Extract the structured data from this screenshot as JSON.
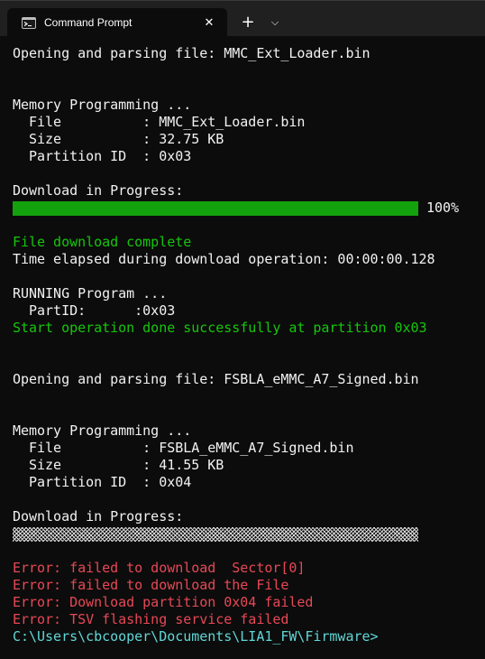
{
  "window": {
    "title": "Command Prompt",
    "close_glyph": "✕",
    "new_tab_glyph": "+",
    "dropdown_glyph": "⌵",
    "app_icon": "console-icon"
  },
  "console": {
    "lines": [
      {
        "text": "Opening and parsing file: MMC_Ext_Loader.bin",
        "color": "white"
      },
      {
        "text": "",
        "color": "white"
      },
      {
        "text": "",
        "color": "white"
      },
      {
        "text": "Memory Programming ...",
        "color": "white"
      },
      {
        "text": "  File          : MMC_Ext_Loader.bin",
        "color": "white"
      },
      {
        "text": "  Size          : 32.75 KB",
        "color": "white"
      },
      {
        "text": "  Partition ID  : 0x03",
        "color": "white"
      },
      {
        "text": "",
        "color": "white"
      },
      {
        "text": "Download in Progress:",
        "color": "white"
      },
      {
        "type": "progress",
        "value": 100,
        "label": "100%",
        "state": "complete"
      },
      {
        "text": "",
        "color": "white"
      },
      {
        "text": "File download complete",
        "color": "green"
      },
      {
        "text": "Time elapsed during download operation: 00:00:00.128",
        "color": "white"
      },
      {
        "text": "",
        "color": "white"
      },
      {
        "text": "RUNNING Program ...",
        "color": "white"
      },
      {
        "text": "  PartID:      :0x03",
        "color": "white"
      },
      {
        "text": "Start operation done successfully at partition 0x03",
        "color": "green"
      },
      {
        "text": "",
        "color": "white"
      },
      {
        "text": "",
        "color": "white"
      },
      {
        "text": "Opening and parsing file: FSBLA_eMMC_A7_Signed.bin",
        "color": "white"
      },
      {
        "text": "",
        "color": "white"
      },
      {
        "text": "",
        "color": "white"
      },
      {
        "text": "Memory Programming ...",
        "color": "white"
      },
      {
        "text": "  File          : FSBLA_eMMC_A7_Signed.bin",
        "color": "white"
      },
      {
        "text": "  Size          : 41.55 KB",
        "color": "white"
      },
      {
        "text": "  Partition ID  : 0x04",
        "color": "white"
      },
      {
        "text": "",
        "color": "white"
      },
      {
        "text": "Download in Progress:",
        "color": "white"
      },
      {
        "type": "progress",
        "value": 0,
        "label": "",
        "state": "failed"
      },
      {
        "text": "",
        "color": "white"
      },
      {
        "text": "Error: failed to download  Sector[0]",
        "color": "red"
      },
      {
        "text": "Error: failed to download the File",
        "color": "red"
      },
      {
        "text": "Error: Download partition 0x04 failed",
        "color": "red"
      },
      {
        "text": "Error: TSV flashing service failed",
        "color": "red"
      },
      {
        "text": "C:\\Users\\cbcooper\\Documents\\LIA1_FW\\Firmware>",
        "color": "cyan"
      }
    ]
  },
  "colors": {
    "background": "#0c0c0c",
    "white": "#f2f2f2",
    "green": "#16c60c",
    "red": "#e74856",
    "cyan": "#61d6d6",
    "progress_fill": "#13a10e"
  }
}
